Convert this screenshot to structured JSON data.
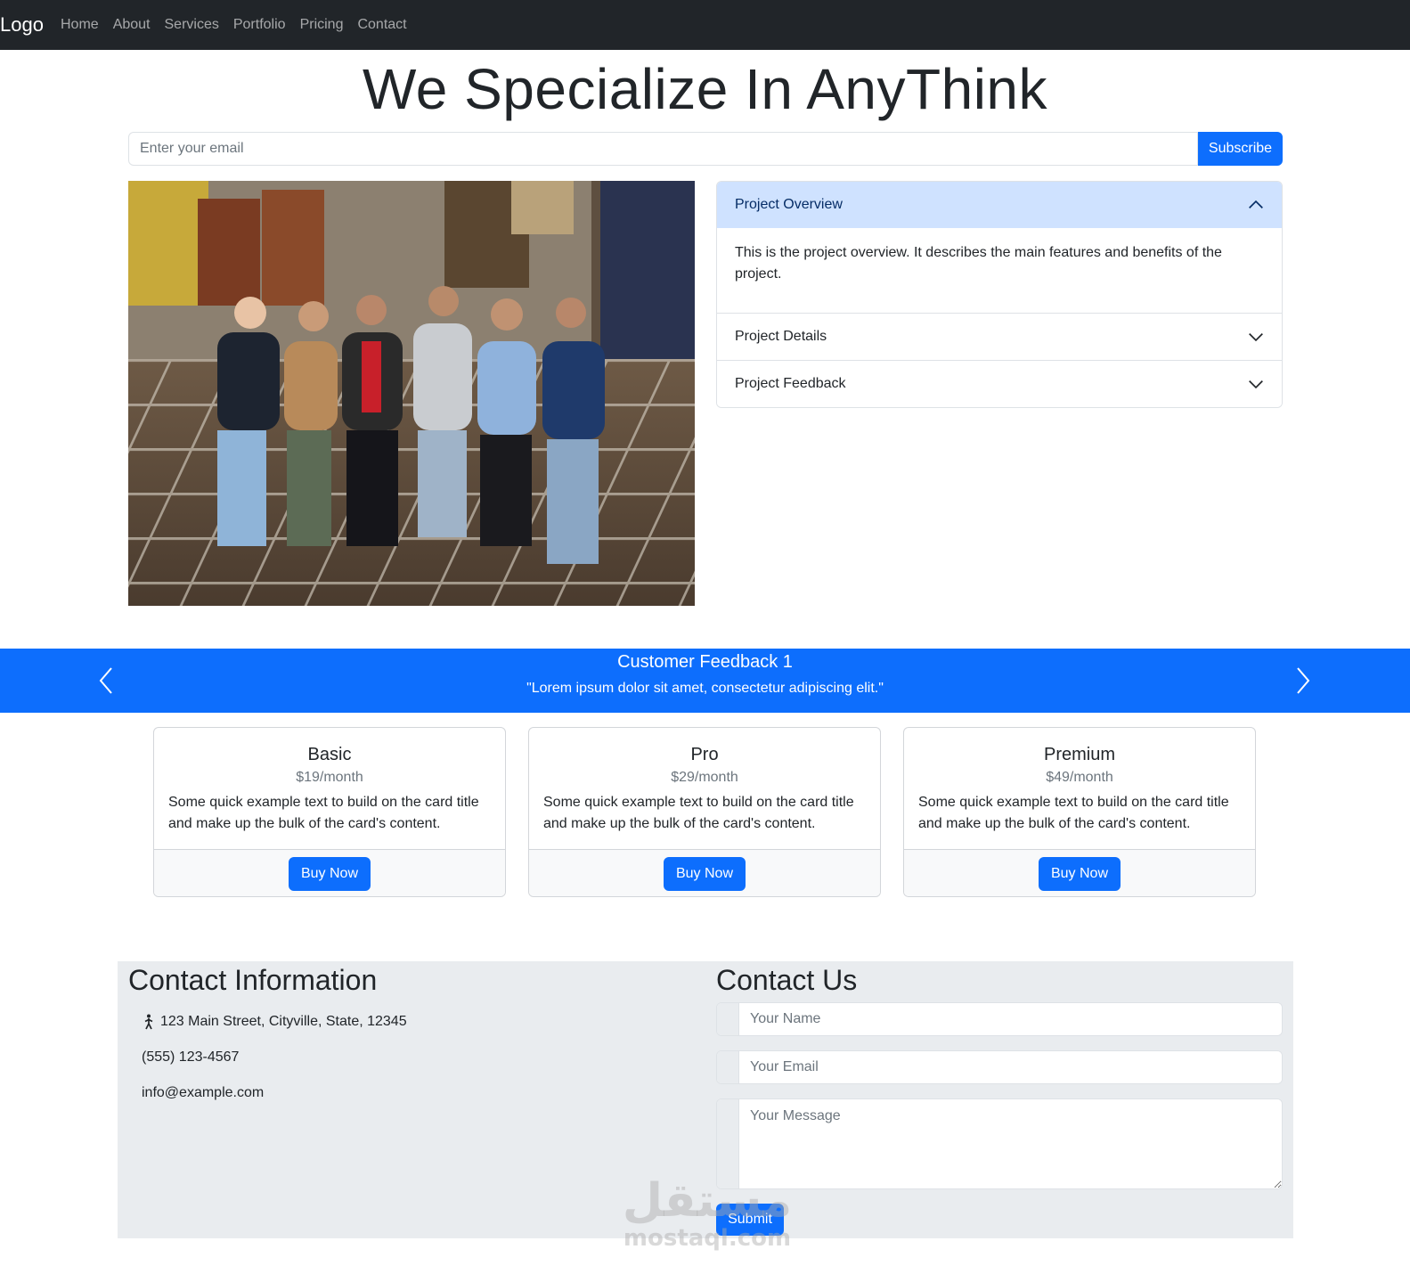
{
  "navbar": {
    "brand": "Logo",
    "links": [
      "Home",
      "About",
      "Services",
      "Portfolio",
      "Pricing",
      "Contact"
    ]
  },
  "hero": {
    "title": "We Specialize In AnyThink",
    "email_placeholder": "Enter your email",
    "subscribe_label": "Subscribe"
  },
  "accordion": {
    "items": [
      {
        "title": "Project Overview",
        "expanded": true,
        "body": "This is the project overview. It describes the main features and benefits of the project."
      },
      {
        "title": "Project Details",
        "expanded": false
      },
      {
        "title": "Project Feedback",
        "expanded": false
      }
    ]
  },
  "carousel": {
    "title": "Customer Feedback 1",
    "quote": "\"Lorem ipsum dolor sit amet, consectetur adipiscing elit.\""
  },
  "pricing": [
    {
      "name": "Basic",
      "price": "$19/month",
      "text": "Some quick example text to build on the card title and make up the bulk of the card's content.",
      "button": "Buy Now"
    },
    {
      "name": "Pro",
      "price": "$29/month",
      "text": "Some quick example text to build on the card title and make up the bulk of the card's content.",
      "button": "Buy Now"
    },
    {
      "name": "Premium",
      "price": "$49/month",
      "text": "Some quick example text to build on the card title and make up the bulk of the card's content.",
      "button": "Buy Now"
    }
  ],
  "contact_info": {
    "title": "Contact Information",
    "address": "123 Main Street, Cityville, State, 12345",
    "phone": "(555) 123-4567",
    "email": "info@example.com"
  },
  "contact_form": {
    "title": "Contact Us",
    "name_placeholder": "Your Name",
    "email_placeholder": "Your Email",
    "message_placeholder": "Your Message",
    "submit_label": "Submit"
  },
  "watermark": {
    "arabic": "مستقل",
    "latin": "mostaql.com"
  },
  "colors": {
    "navbar": "#212529",
    "primary": "#0d6efd",
    "accordion_active": "#cfe2ff",
    "contact_bg": "#e9ecef"
  },
  "icons": {
    "address": "person-walking-icon",
    "accordion_open": "chevron-up-icon",
    "accordion_closed": "chevron-down-icon",
    "carousel_prev": "chevron-left-icon",
    "carousel_next": "chevron-right-icon"
  }
}
